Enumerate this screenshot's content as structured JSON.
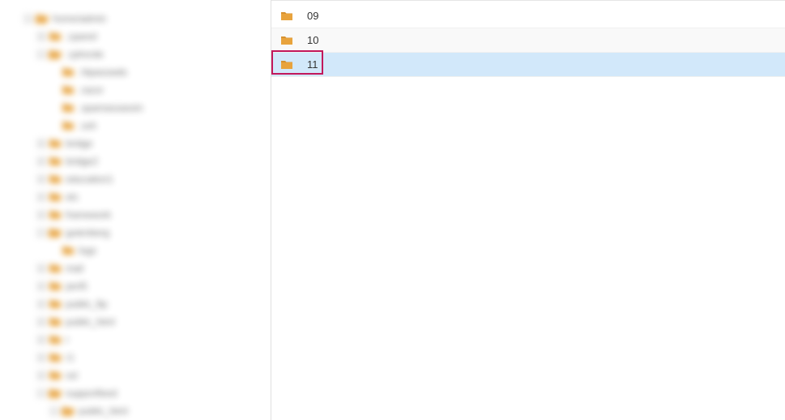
{
  "sidebar": {
    "items": [
      {
        "label": "home/admin",
        "indent": 0,
        "toggle": "minus",
        "open": true
      },
      {
        "label": ".cpanel",
        "indent": 1,
        "toggle": "plus",
        "open": false
      },
      {
        "label": ".cphorde",
        "indent": 1,
        "toggle": "minus",
        "open": true
      },
      {
        "label": ".htpasswds",
        "indent": 2,
        "toggle": "none",
        "open": false
      },
      {
        "label": ".razor",
        "indent": 2,
        "toggle": "none",
        "open": false
      },
      {
        "label": ".spamassassin",
        "indent": 2,
        "toggle": "none",
        "open": false
      },
      {
        "label": ".ssh",
        "indent": 2,
        "toggle": "none",
        "open": false
      },
      {
        "label": "bridge",
        "indent": 1,
        "toggle": "plus",
        "open": false
      },
      {
        "label": "bridge2",
        "indent": 1,
        "toggle": "plus",
        "open": false
      },
      {
        "label": "education1",
        "indent": 1,
        "toggle": "plus",
        "open": false
      },
      {
        "label": "etc",
        "indent": 1,
        "toggle": "plus",
        "open": false
      },
      {
        "label": "framework",
        "indent": 1,
        "toggle": "plus",
        "open": false
      },
      {
        "label": "gutenberg",
        "indent": 1,
        "toggle": "minus",
        "open": true
      },
      {
        "label": "logs",
        "indent": 2,
        "toggle": "none",
        "open": false
      },
      {
        "label": "mail",
        "indent": 1,
        "toggle": "plus",
        "open": false
      },
      {
        "label": "perl5",
        "indent": 1,
        "toggle": "plus",
        "open": false
      },
      {
        "label": "public_ftp",
        "indent": 1,
        "toggle": "plus",
        "open": false
      },
      {
        "label": "public_html",
        "indent": 1,
        "toggle": "plus",
        "open": false
      },
      {
        "label": "r",
        "indent": 1,
        "toggle": "plus",
        "open": false
      },
      {
        "label": "r1",
        "indent": 1,
        "toggle": "plus",
        "open": false
      },
      {
        "label": "ssl",
        "indent": 1,
        "toggle": "plus",
        "open": false
      },
      {
        "label": "supportfeed",
        "indent": 1,
        "toggle": "minus",
        "open": true
      },
      {
        "label": "public_html",
        "indent": 2,
        "toggle": "minus",
        "open": true
      }
    ]
  },
  "main": {
    "rows": [
      {
        "label": "09",
        "selected": false,
        "alt": false
      },
      {
        "label": "10",
        "selected": false,
        "alt": true
      },
      {
        "label": "11",
        "selected": true,
        "alt": false
      }
    ],
    "highlight_index": 2
  }
}
